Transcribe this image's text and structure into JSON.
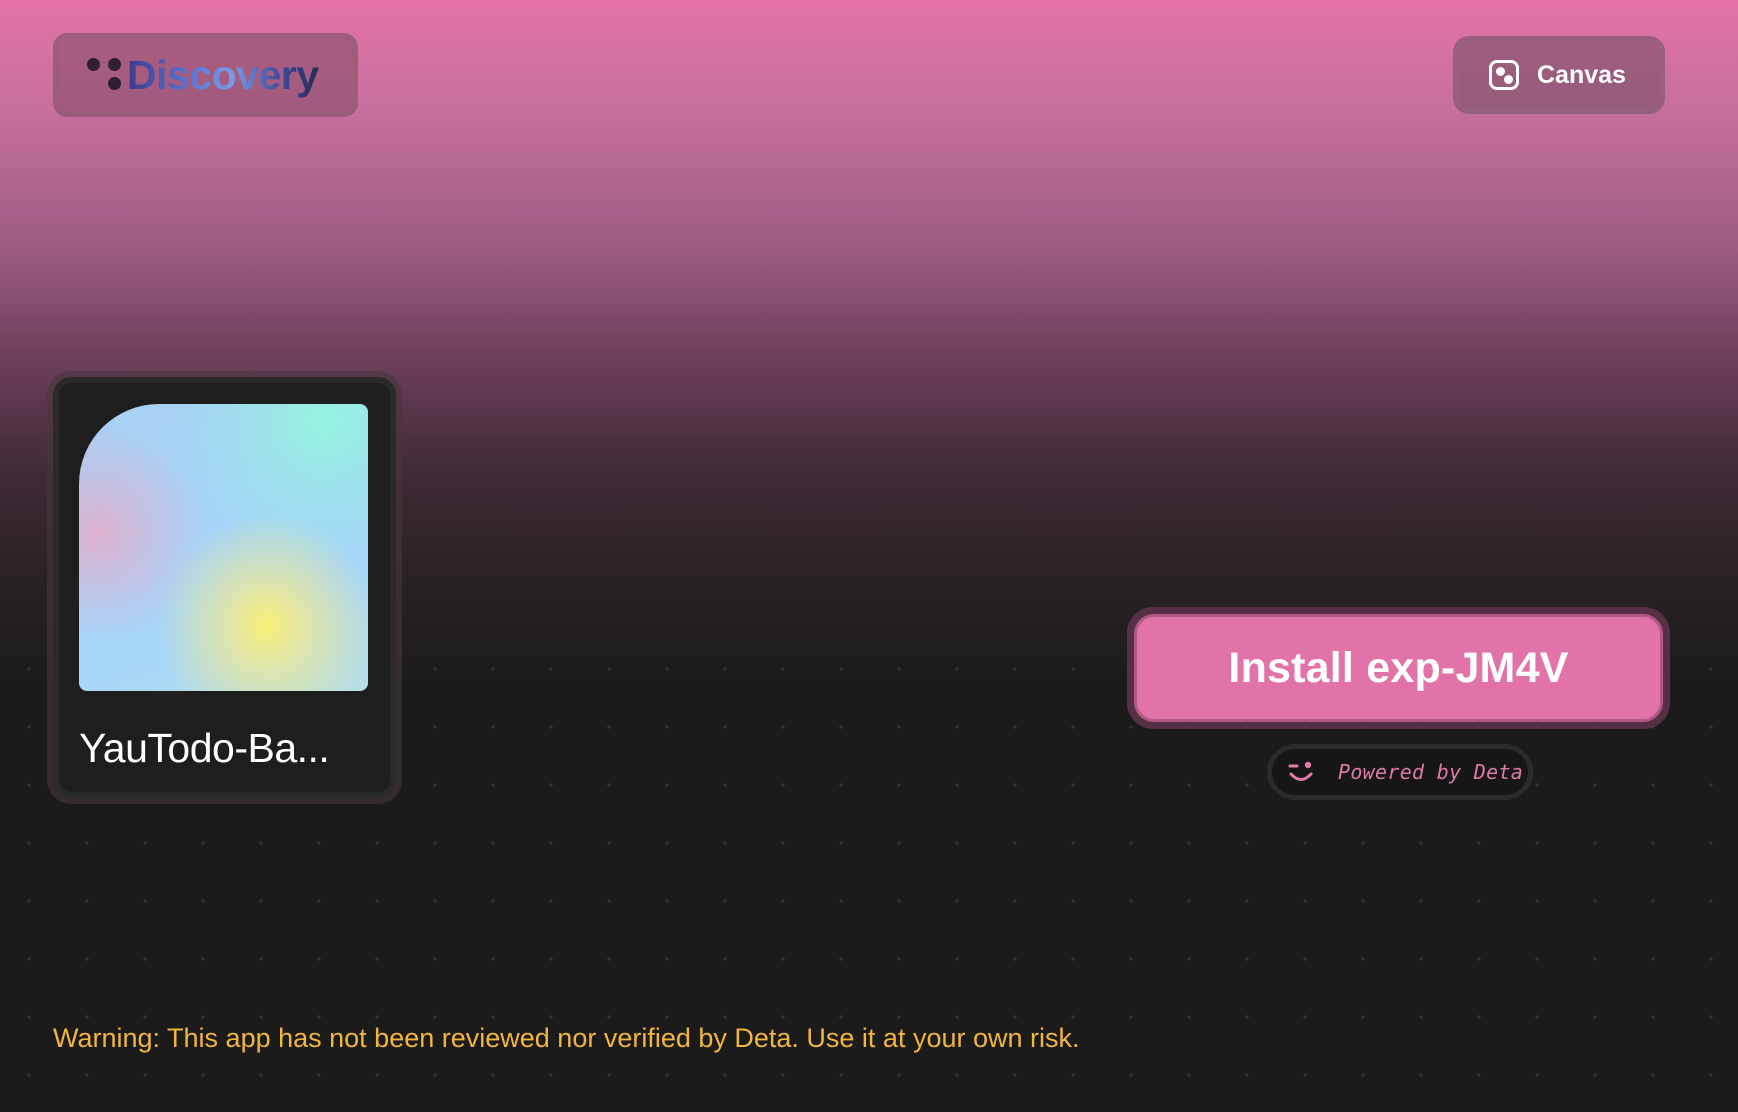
{
  "header": {
    "logo_text": "Discovery",
    "canvas_label": "Canvas"
  },
  "app": {
    "name": "YauTodo-Ba..."
  },
  "install": {
    "label": "Install exp-JM4V"
  },
  "powered_by": {
    "label": "Powered by Deta"
  },
  "warning": {
    "text": "Warning: This app has not been reviewed nor verified by Deta. Use it at your own risk."
  },
  "colors": {
    "accent_pink": "#e273a9",
    "warning_yellow": "#f2b53d",
    "background_dark": "#1b1b1b"
  },
  "icons": {
    "logo": "discovery-dots-icon",
    "canvas": "canvas-dice-icon",
    "powered": "wink-face-icon"
  }
}
